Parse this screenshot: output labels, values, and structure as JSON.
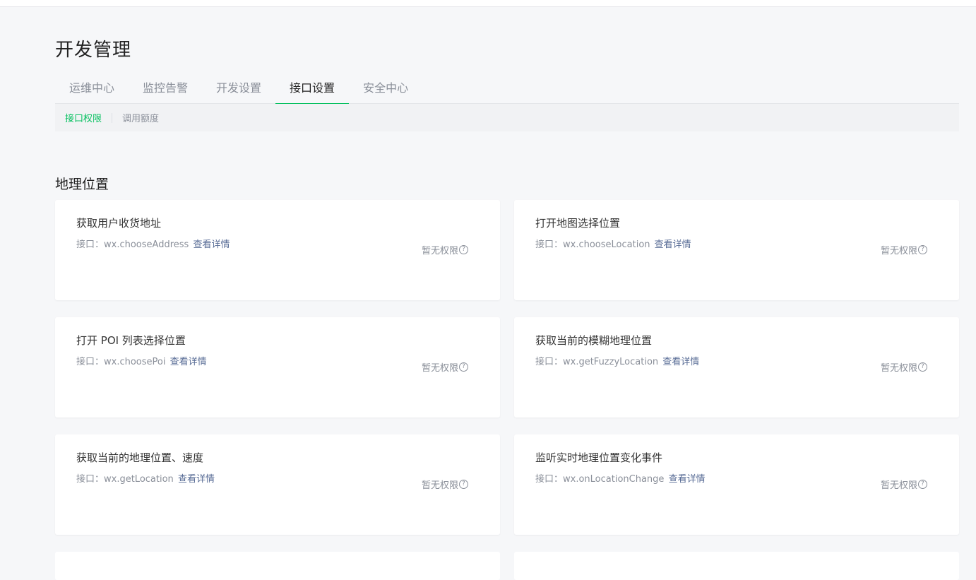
{
  "header": {
    "title": "开发管理"
  },
  "tabs": [
    {
      "label": "运维中心"
    },
    {
      "label": "监控告警"
    },
    {
      "label": "开发设置"
    },
    {
      "label": "接口设置"
    },
    {
      "label": "安全中心"
    }
  ],
  "active_tab": "接口设置",
  "subtabs": [
    {
      "label": "接口权限"
    },
    {
      "label": "调用额度"
    }
  ],
  "active_subtab": "接口权限",
  "section": {
    "title": "地理位置"
  },
  "cards": [
    {
      "title": "获取用户收货地址",
      "api": "接口：wx.chooseAddress",
      "link": "查看详情",
      "status": "暂无权限"
    },
    {
      "title": "打开地图选择位置",
      "api": "接口：wx.chooseLocation",
      "link": "查看详情",
      "status": "暂无权限"
    },
    {
      "title": "打开 POI 列表选择位置",
      "api": "接口：wx.choosePoi",
      "link": "查看详情",
      "status": "暂无权限"
    },
    {
      "title": "获取当前的模糊地理位置",
      "api": "接口：wx.getFuzzyLocation",
      "link": "查看详情",
      "status": "暂无权限"
    },
    {
      "title": "获取当前的地理位置、速度",
      "api": "接口：wx.getLocation",
      "link": "查看详情",
      "status": "暂无权限"
    },
    {
      "title": "监听实时地理位置变化事件",
      "api": "接口：wx.onLocationChange",
      "link": "查看详情",
      "status": "暂无权限"
    }
  ],
  "icons": {
    "help": "question-circle-icon"
  },
  "colors": {
    "accent": "#07c160",
    "link": "#576b95",
    "muted": "#8a8f99",
    "background": "#f6f7f9"
  }
}
